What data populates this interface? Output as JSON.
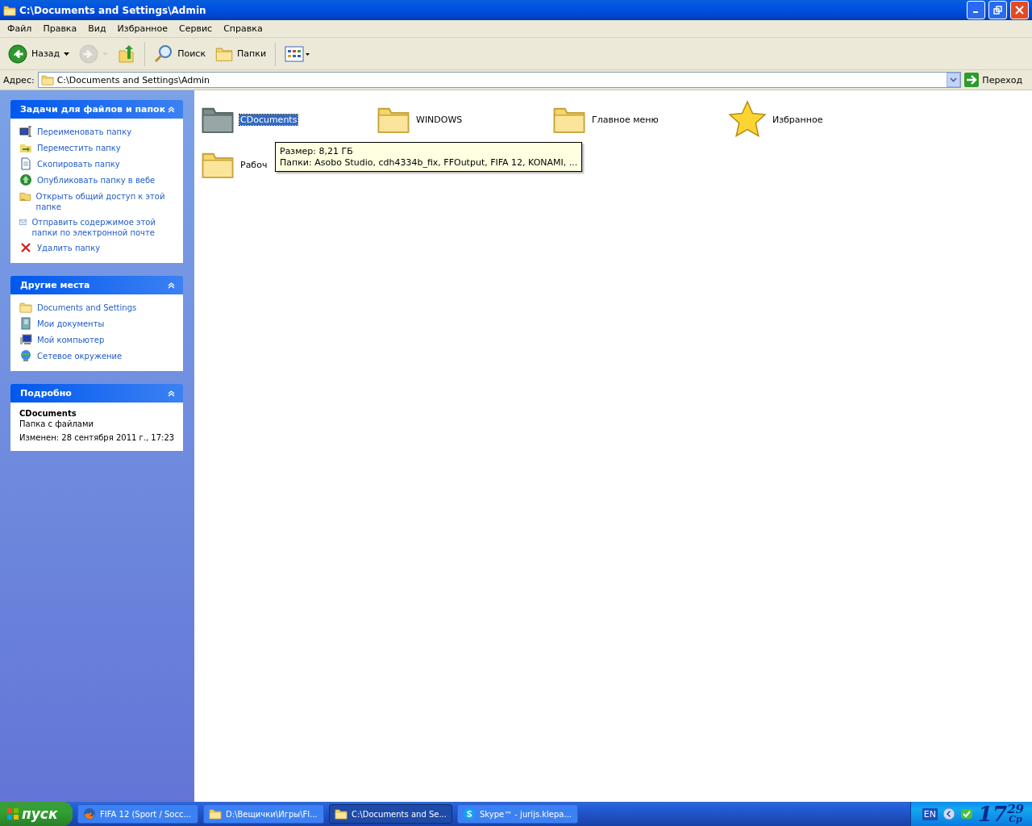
{
  "window": {
    "title": "C:\\Documents and Settings\\Admin"
  },
  "menu": [
    "Файл",
    "Правка",
    "Вид",
    "Избранное",
    "Сервис",
    "Справка"
  ],
  "toolbar": [
    {
      "kind": "back",
      "label": "Назад",
      "disabled": false
    },
    {
      "kind": "forward",
      "disabled": true
    },
    {
      "kind": "up",
      "disabled": false
    },
    {
      "kind": "search",
      "label": "Поиск",
      "disabled": false
    },
    {
      "kind": "folders",
      "label": "Папки",
      "disabled": false
    },
    {
      "kind": "views",
      "disabled": false
    }
  ],
  "address": {
    "label": "Адрес:",
    "value": "C:\\Documents and Settings\\Admin",
    "go_label": "Переход"
  },
  "sidebar": [
    {
      "title": "Задачи для файлов и папок",
      "items": [
        "Переименовать папку",
        "Переместить папку",
        "Скопировать папку",
        "Опубликовать папку в вебе",
        "Открыть общий доступ к этой папке",
        "Отправить содержимое этой папки по электронной почте",
        "Удалить папку"
      ]
    },
    {
      "title": "Другие места",
      "items": [
        "Documents and Settings",
        "Мои документы",
        "Мой компьютер",
        "Сетевое окружение"
      ]
    }
  ],
  "details": {
    "title": "Подробно",
    "name": "CDocuments",
    "type": "Папка с файлами",
    "modified": "Изменен: 28 сентября 2011 г., 17:23"
  },
  "files": [
    {
      "kind": "gray_folder",
      "name": "CDocuments",
      "selected": true
    },
    {
      "kind": "folder",
      "name": "WINDOWS",
      "selected": false
    },
    {
      "kind": "folder",
      "name": "Главное меню",
      "selected": false
    },
    {
      "kind": "star",
      "name": "Избранное",
      "selected": false
    },
    {
      "kind": "folder",
      "name": "Рабоч",
      "selected": false
    }
  ],
  "tooltip": [
    "Размер: 8,21 ГБ",
    "Папки: Asobo Studio, cdh4334b_fix, FFOutput, FIFA 12, KONAMI, ..."
  ],
  "taskbar": {
    "start": "пуск",
    "tasks": [
      {
        "label": "FIFA 12 (Sport / Socc...",
        "selected": false
      },
      {
        "label": "D:\\Вещички\\Игры\\FI...",
        "selected": false
      },
      {
        "label": "C:\\Documents and Se...",
        "selected": true
      },
      {
        "label": "Skype™ - jurijs.klepa...",
        "selected": false
      }
    ],
    "lang": "EN",
    "hour": "17",
    "minute": "29",
    "day": "Ср"
  }
}
